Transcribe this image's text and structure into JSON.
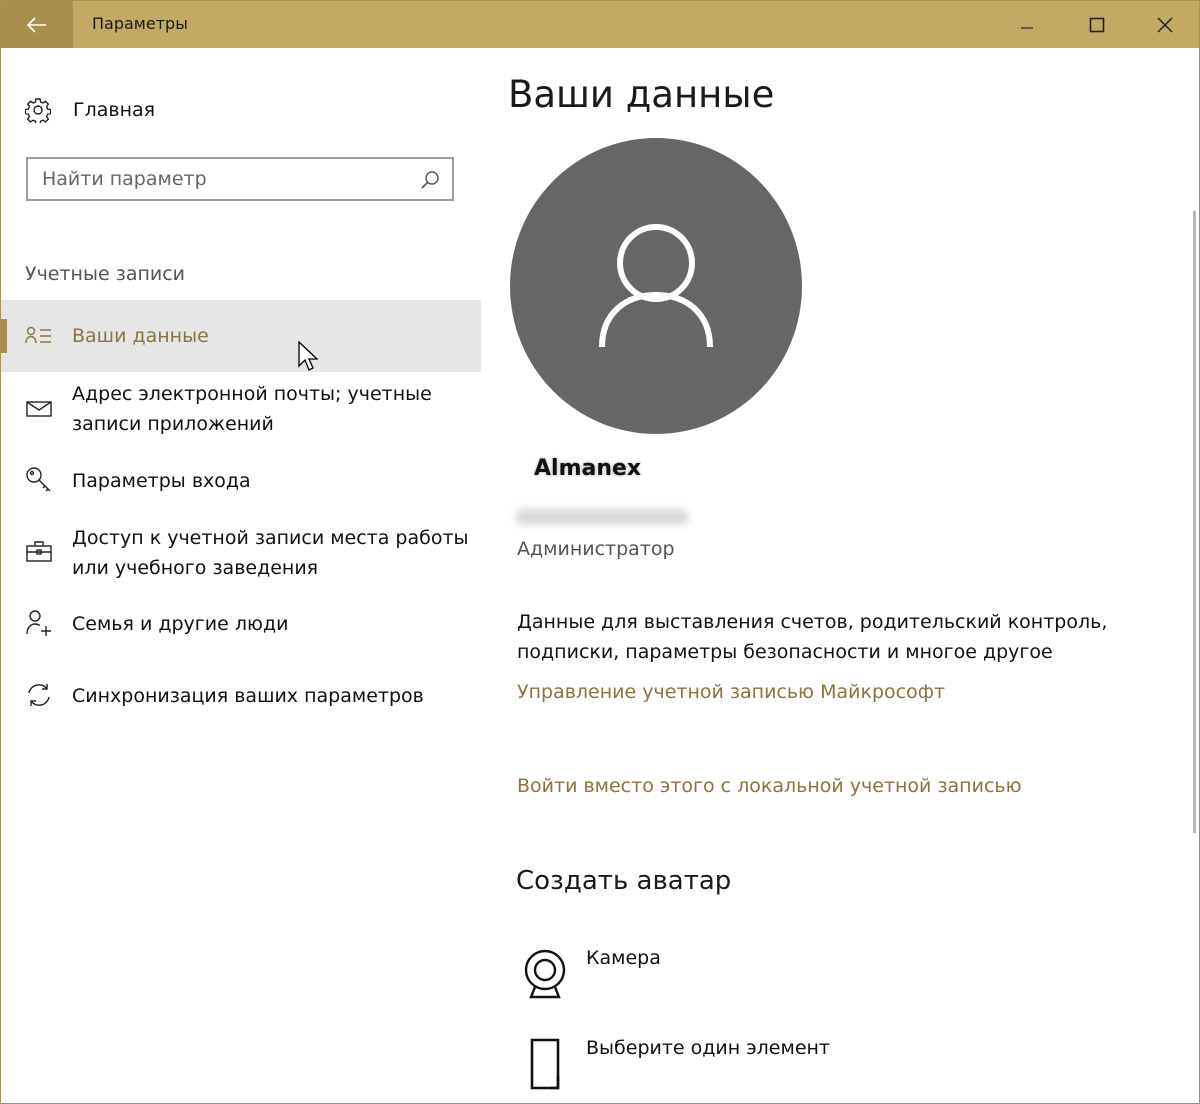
{
  "window": {
    "title": "Параметры",
    "accent": "#c2a964",
    "accent_dark": "#a88f4d",
    "link_color": "#8a7440"
  },
  "sidebar": {
    "home_label": "Главная",
    "search_placeholder": "Найти параметр",
    "section_label": "Учетные записи",
    "items": [
      {
        "label": "Ваши данные",
        "icon": "person-list-icon",
        "active": true
      },
      {
        "label": "Адрес электронной почты; учетные записи приложений",
        "icon": "mail-icon"
      },
      {
        "label": "Параметры входа",
        "icon": "key-icon"
      },
      {
        "label": "Доступ к учетной записи места работы или учебного заведения",
        "icon": "briefcase-icon"
      },
      {
        "label": "Семья и другие люди",
        "icon": "add-person-icon"
      },
      {
        "label": "Синхронизация ваших параметров",
        "icon": "sync-icon"
      }
    ]
  },
  "main": {
    "title": "Ваши данные",
    "user_name": "Almanex",
    "role": "Администратор",
    "description": "Данные для выставления счетов, родительский контроль, подписки, параметры безопасности и многое другое",
    "manage_link": "Управление учетной записью Майкрософт",
    "local_link": "Войти вместо этого с локальной учетной записью",
    "avatar_heading": "Создать аватар",
    "avatar_options": [
      {
        "label": "Камера",
        "icon": "webcam-icon"
      },
      {
        "label": "Выберите один элемент",
        "icon": "file-icon"
      }
    ]
  }
}
